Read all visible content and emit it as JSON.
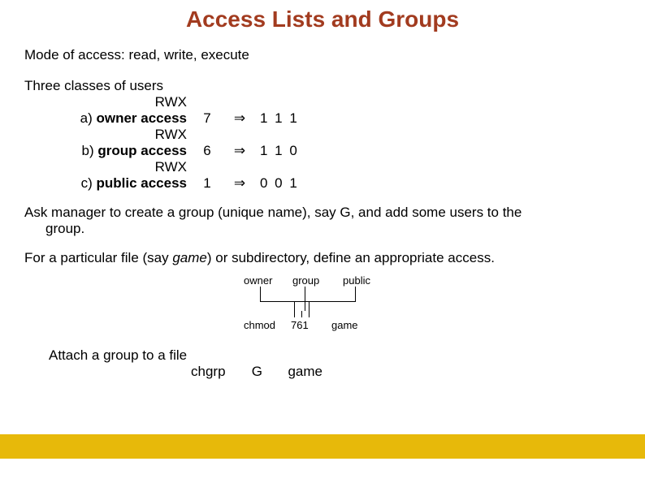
{
  "title": "Access Lists and Groups",
  "mode_line": "Mode of access:  read, write, execute",
  "classes_intro": "Three classes of users",
  "rwx": "RWX",
  "rows": {
    "a": {
      "label_prefix": "a) ",
      "label_bold": "owner access",
      "num": "7",
      "arrow": "⇒",
      "bits": "1 1 1"
    },
    "b": {
      "label_prefix": "b) ",
      "label_bold": "group access",
      "num": "6",
      "arrow": "⇒",
      "bits": "1 1 0"
    },
    "c": {
      "label_prefix": "c) ",
      "label_bold": "public access",
      "num": "1",
      "arrow": "⇒",
      "bits": "0 0 1"
    }
  },
  "ask_line1": "Ask manager to create a group (unique name), say G, and add some users to the",
  "ask_line2": "group.",
  "define_pre": "For a particular file (say ",
  "define_game": "game",
  "define_post": ") or subdirectory, define an appropriate access.",
  "diagram": {
    "owner": "owner",
    "group": "group",
    "public": "public",
    "chmod": "chmod",
    "val": "761",
    "file": "game"
  },
  "attach": "Attach a group to a file",
  "chgrp": {
    "cmd": "chgrp",
    "group": "G",
    "file": "game"
  }
}
